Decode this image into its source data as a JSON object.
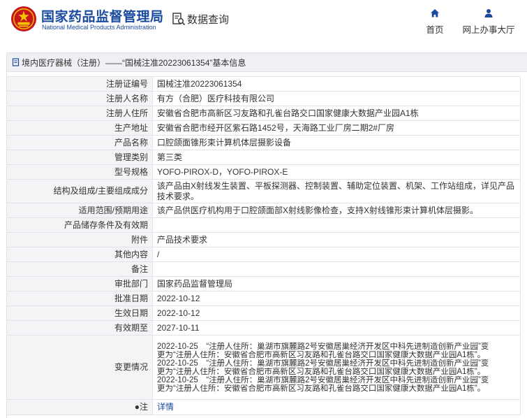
{
  "header": {
    "site_name_cn": "国家药品监督管理局",
    "site_name_en": "National Medical Products Administration",
    "page_title": "数据查询",
    "nav": {
      "home": "首页",
      "service_hall": "网上办事大厅"
    },
    "logo_text": "国家药品监督管理局"
  },
  "panel": {
    "breadcrumb": "境内医疗器械（注册）——“国械注准20223061354”基本信息"
  },
  "rows": [
    {
      "label": "注册证编号",
      "value": "国械注准20223061354"
    },
    {
      "label": "注册人名称",
      "value": "有方（合肥）医疗科技有限公司"
    },
    {
      "label": "注册人住所",
      "value": "安徽省合肥市高新区习友路和孔雀台路交口国家健康大数据产业园A1栋"
    },
    {
      "label": "生产地址",
      "value": "安徽省合肥市经开区紫石路1452号，天海路工业厂房二期2#厂房"
    },
    {
      "label": "产品名称",
      "value": "口腔颌面锥形束计算机体层摄影设备"
    },
    {
      "label": "管理类别",
      "value": "第三类"
    },
    {
      "label": "型号规格",
      "value": "YOFO-PIROX-D，YOFO-PIROX-E"
    },
    {
      "label": "结构及组成/主要组成成分",
      "value": "该产品由X射线发生装置、平板探测器、控制装置、辅助定位装置、机架、工作站组成，详见产品技术要求。"
    },
    {
      "label": "适用范围/预期用途",
      "value": "该产品供医疗机构用于口腔颌面部X射线影像检查，支持X射线锥形束计算机体层摄影。"
    },
    {
      "label": "产品储存条件及有效期",
      "value": ""
    },
    {
      "label": "附件",
      "value": "产品技术要求"
    },
    {
      "label": "其他内容",
      "value": "/"
    },
    {
      "label": "备注",
      "value": ""
    },
    {
      "label": "审批部门",
      "value": "国家药品监督管理局"
    },
    {
      "label": "批准日期",
      "value": "2022-10-12"
    },
    {
      "label": "生效日期",
      "value": "2022-10-12"
    },
    {
      "label": "有效期至",
      "value": "2027-10-11"
    }
  ],
  "change": {
    "label": "变更情况",
    "lines": [
      "2022-10-25　“注册人住所：巢湖市旗麓路2号安徽居巢经济开发区中科先进制造创新产业园”变",
      "更为“注册人住所：安徽省合肥市高新区习友路和孔雀台路交口国家健康大数据产业园A1栋”。",
      "2022-10-25　“注册人住所：巢湖市旗麓路2号安徽居巢经济开发区中科先进制造创新产业园”变",
      "更为“注册人住所：安徽省合肥市高新区习友路和孔雀台路交口国家健康大数据产业园A1栋”。",
      "2022-10-25　“注册人住所：巢湖市旗麓路2号安徽居巢经济开发区中科先进制造创新产业园”变",
      "更为“注册人住所：安徽省合肥市高新区习友路和孔雀台路交口国家健康大数据产业园A1栋”。"
    ]
  },
  "note": {
    "label": "注",
    "link": "详情"
  },
  "colors": {
    "brand_blue": "#1a4a9e",
    "logo_red": "#c8161d",
    "label_bg": "#f3f4f6",
    "head_bg": "#eef0f3"
  }
}
